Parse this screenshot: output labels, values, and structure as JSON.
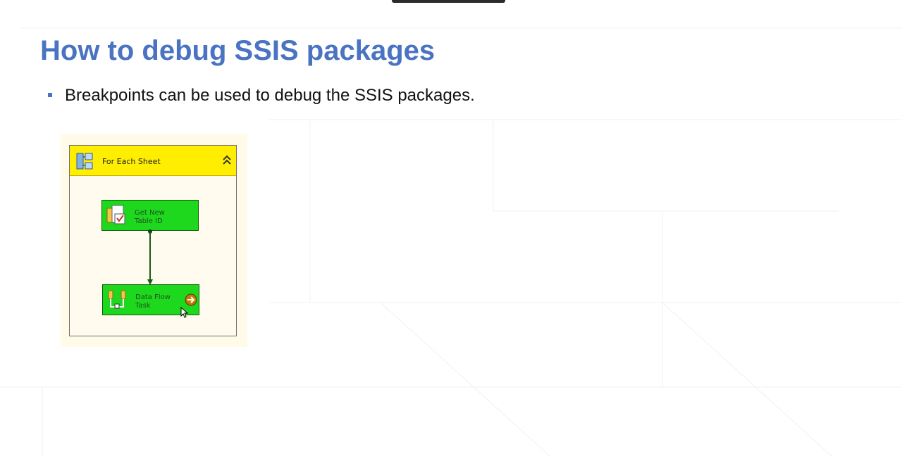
{
  "slide": {
    "title": "How to debug SSIS packages",
    "bullets": [
      {
        "text": "Breakpoints can be used to debug the SSIS packages."
      }
    ]
  },
  "ssis_designer": {
    "container": {
      "label": "For Each Sheet",
      "icon": "foreach-loop-icon",
      "collapse_icon": "collapse-chevrons-icon",
      "header_color": "#ffee00"
    },
    "tasks": [
      {
        "label_line1": "Get New",
        "label_line2": "Table ID",
        "icon": "sql-task-icon",
        "color": "#1ed81e"
      },
      {
        "label_line1": "Data Flow",
        "label_line2": "Task",
        "icon": "data-flow-icon",
        "color": "#1ed81e",
        "status_icon": "breakpoint-arrow-icon"
      }
    ],
    "connector": "success-precedence-arrow"
  },
  "colors": {
    "title": "#4a73c2",
    "bullet": "#4a73c2",
    "text": "#111111"
  }
}
